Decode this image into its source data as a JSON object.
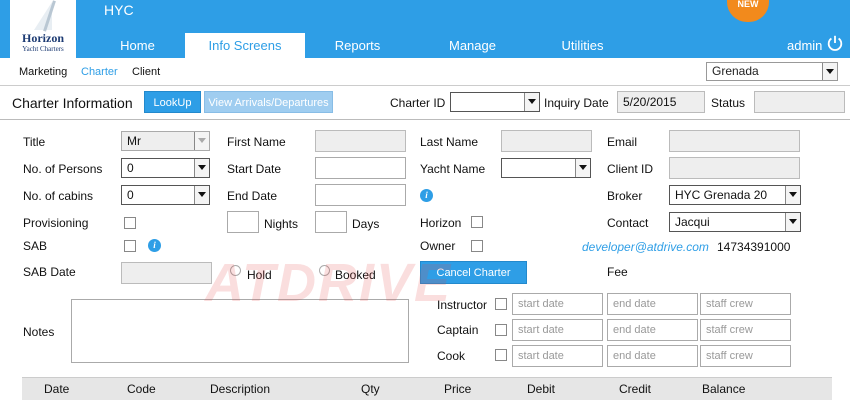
{
  "header": {
    "logo_brand": "Horizon",
    "logo_sub": "Yacht Charters",
    "app_title": "HYC",
    "new_badge": "NEW",
    "user": "admin",
    "tabs": [
      {
        "label": "Home"
      },
      {
        "label": "Info Screens"
      },
      {
        "label": "Reports"
      },
      {
        "label": "Manage"
      },
      {
        "label": "Utilities"
      }
    ]
  },
  "subnav": {
    "items": [
      {
        "label": "Marketing"
      },
      {
        "label": "Charter"
      },
      {
        "label": "Client"
      }
    ],
    "region": "Grenada"
  },
  "section": {
    "title": "Charter Information",
    "lookup_button": "LookUp",
    "view_button": "View Arrivals/Departures",
    "charter_id_label": "Charter ID",
    "charter_id_value": "",
    "inquiry_date_label": "Inquiry Date",
    "inquiry_date_value": "5/20/2015",
    "status_label": "Status",
    "status_value": ""
  },
  "form": {
    "title_label": "Title",
    "title_value": "Mr",
    "persons_label": "No. of Persons",
    "persons_value": "0",
    "cabins_label": "No. of cabins",
    "cabins_value": "0",
    "provisioning_label": "Provisioning",
    "sab_label": "SAB",
    "sab_date_label": "SAB Date",
    "first_name_label": "First Name",
    "start_date_label": "Start Date",
    "end_date_label": "End Date",
    "nights_label": "Nights",
    "days_label": "Days",
    "hold_label": "Hold",
    "booked_label": "Booked",
    "last_name_label": "Last Name",
    "yacht_name_label": "Yacht Name",
    "horizon_label": "Horizon",
    "owner_label": "Owner",
    "cancel_button": "Cancel Charter",
    "email_label": "Email",
    "client_id_label": "Client ID",
    "broker_label": "Broker",
    "broker_value": "HYC Grenada 20",
    "contact_label": "Contact",
    "contact_value": "Jacqui",
    "contact_email": "developer@atdrive.com",
    "contact_phone": "14734391000",
    "fee_label": "Fee",
    "notes_label": "Notes",
    "staff": [
      {
        "label": "Instructor",
        "start_ph": "start date",
        "end_ph": "end date",
        "crew_ph": "staff crew"
      },
      {
        "label": "Captain",
        "start_ph": "start date",
        "end_ph": "end date",
        "crew_ph": "staff crew"
      },
      {
        "label": "Cook",
        "start_ph": "start date",
        "end_ph": "end date",
        "crew_ph": "staff crew"
      }
    ]
  },
  "table": {
    "columns": [
      "Date",
      "Code",
      "Description",
      "Qty",
      "Price",
      "Debit",
      "Credit",
      "Balance"
    ]
  },
  "watermark": "ATDRIVE",
  "colors": {
    "accent": "#2e9ee6",
    "badge": "#f28a1c"
  }
}
